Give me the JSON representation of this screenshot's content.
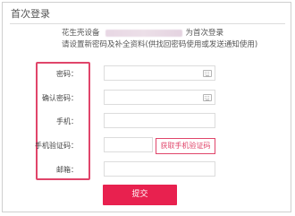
{
  "dialog": {
    "title": "首次登录",
    "intro_prefix": "花生壳设备",
    "intro_suffix": "为首次登录",
    "intro_line2": "请设置新密码及补全资料(供找回密码使用或发送通知使用)"
  },
  "form": {
    "password_label": "密码：",
    "confirm_label": "确认密码：",
    "phone_label": "手机：",
    "code_label": "手机验证码：",
    "email_label": "邮箱：",
    "password_value": "",
    "confirm_value": "",
    "phone_value": "",
    "code_value": "",
    "email_value": ""
  },
  "buttons": {
    "get_code": "获取手机验证码",
    "submit": "提交"
  },
  "colors": {
    "accent": "#e8214f",
    "highlight_border": "#e0456a"
  },
  "icons": {
    "keyboard": "keyboard-icon"
  }
}
